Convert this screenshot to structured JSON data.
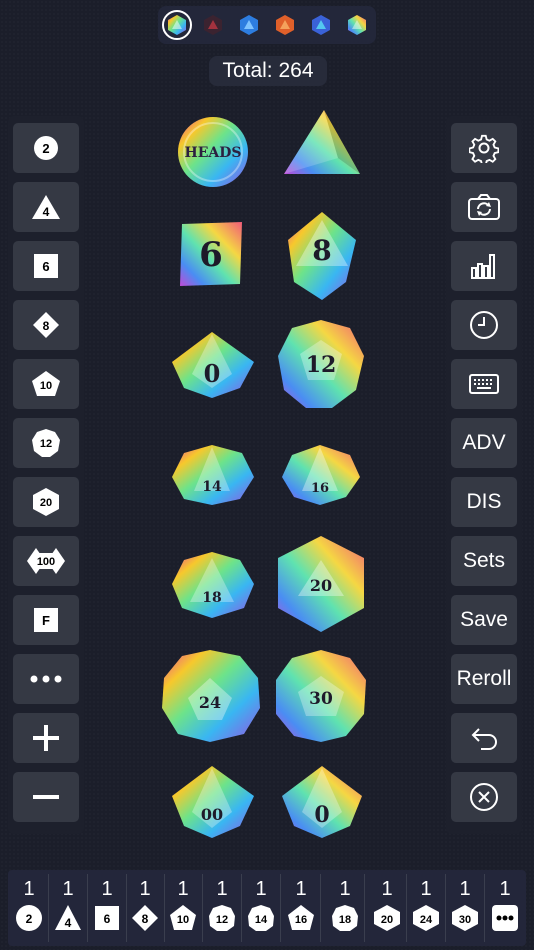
{
  "skins": [
    "rainbow-hex",
    "dark-red",
    "blue-crystal",
    "orange-red",
    "blue-purple",
    "rainbow-small"
  ],
  "total_label": "Total: 264",
  "left_buttons": [
    {
      "name": "coin-button",
      "label": "2",
      "shape": "circle"
    },
    {
      "name": "d4-button",
      "label": "4",
      "shape": "triangle"
    },
    {
      "name": "d6-button",
      "label": "6",
      "shape": "square"
    },
    {
      "name": "d8-button",
      "label": "8",
      "shape": "diamond"
    },
    {
      "name": "d10-button",
      "label": "10",
      "shape": "d10"
    },
    {
      "name": "d12-button",
      "label": "12",
      "shape": "d12"
    },
    {
      "name": "d20-button",
      "label": "20",
      "shape": "d20"
    },
    {
      "name": "d100-button",
      "label": "100",
      "shape": "d100"
    },
    {
      "name": "fudge-button",
      "label": "F",
      "shape": "square"
    },
    {
      "name": "more-button",
      "label": "",
      "shape": "dots"
    },
    {
      "name": "add-button",
      "label": "",
      "shape": "plus"
    },
    {
      "name": "remove-button",
      "label": "",
      "shape": "minus"
    }
  ],
  "right_buttons": {
    "settings_icon": "gear-icon",
    "camera_icon": "camera-rotate-icon",
    "stats_icon": "bar-chart-icon",
    "history_icon": "clock-icon",
    "keyboard_icon": "keyboard-icon",
    "adv": "ADV",
    "dis": "DIS",
    "sets": "Sets",
    "save": "Save",
    "reroll": "Reroll",
    "undo_icon": "undo-icon",
    "clear_icon": "close-circle-icon"
  },
  "dice": [
    {
      "name": "coin-die",
      "value": "HEADS"
    },
    {
      "name": "d4-die",
      "value": ""
    },
    {
      "name": "d6-die",
      "value": "6"
    },
    {
      "name": "d8-die",
      "value": "8"
    },
    {
      "name": "d10-die",
      "value": "0"
    },
    {
      "name": "d12-die",
      "value": "12"
    },
    {
      "name": "d14-die",
      "value": "14"
    },
    {
      "name": "d16-die",
      "value": "16"
    },
    {
      "name": "d18-die",
      "value": "18"
    },
    {
      "name": "d20-die",
      "value": "20"
    },
    {
      "name": "d24-die",
      "value": "24"
    },
    {
      "name": "d30-die",
      "value": "30"
    },
    {
      "name": "d100-die",
      "value": "00"
    },
    {
      "name": "d10b-die",
      "value": "0"
    }
  ],
  "dice_tray": [
    {
      "count": "1",
      "label": "2",
      "shape": "circle"
    },
    {
      "count": "1",
      "label": "4",
      "shape": "triangle"
    },
    {
      "count": "1",
      "label": "6",
      "shape": "square"
    },
    {
      "count": "1",
      "label": "8",
      "shape": "diamond"
    },
    {
      "count": "1",
      "label": "10",
      "shape": "d10"
    },
    {
      "count": "1",
      "label": "12",
      "shape": "d12"
    },
    {
      "count": "1",
      "label": "14",
      "shape": "d12"
    },
    {
      "count": "1",
      "label": "16",
      "shape": "d10"
    },
    {
      "count": "1",
      "label": "18",
      "shape": "d12"
    },
    {
      "count": "1",
      "label": "20",
      "shape": "d20"
    },
    {
      "count": "1",
      "label": "24",
      "shape": "d20"
    },
    {
      "count": "1",
      "label": "30",
      "shape": "d20"
    },
    {
      "count": "1",
      "label": "",
      "shape": "dots"
    }
  ]
}
